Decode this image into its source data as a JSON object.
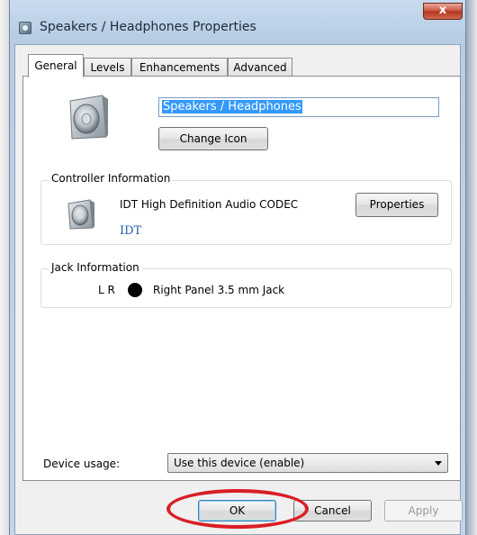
{
  "window": {
    "title": "Speakers / Headphones Properties",
    "close_label": "x"
  },
  "tabs": [
    {
      "label": "General",
      "active": true
    },
    {
      "label": "Levels",
      "active": false
    },
    {
      "label": "Enhancements",
      "active": false
    },
    {
      "label": "Advanced",
      "active": false
    }
  ],
  "device": {
    "name_value": "Speakers / Headphones",
    "change_icon_label": "Change Icon"
  },
  "controller": {
    "group_title": "Controller Information",
    "name": "IDT High Definition Audio CODEC",
    "vendor_link": "IDT",
    "properties_label": "Properties"
  },
  "jack": {
    "group_title": "Jack Information",
    "channels": "L R",
    "description": "Right Panel 3.5 mm Jack"
  },
  "usage": {
    "label": "Device usage:",
    "selected": "Use this device (enable)"
  },
  "footer": {
    "ok_label": "OK",
    "cancel_label": "Cancel",
    "apply_label": "Apply"
  },
  "colors": {
    "highlight": "#3399ff",
    "link": "#1e5fb4",
    "annotation_circle": "#d81f25"
  }
}
